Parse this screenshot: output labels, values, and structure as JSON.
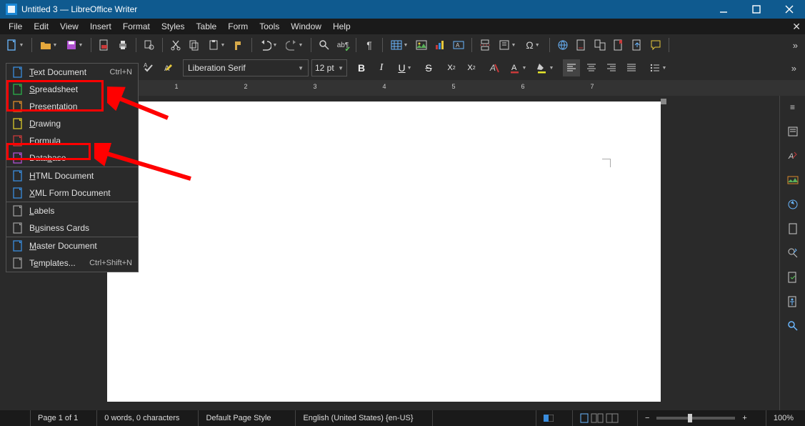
{
  "titlebar": {
    "title": "Untitled 3 — LibreOffice Writer"
  },
  "menubar": {
    "items": [
      "File",
      "Edit",
      "View",
      "Insert",
      "Format",
      "Styles",
      "Table",
      "Form",
      "Tools",
      "Window",
      "Help"
    ]
  },
  "toolbar2": {
    "font_name": "Liberation Serif",
    "font_size": "12 pt"
  },
  "newdoc_menu": {
    "items": [
      {
        "label": "Text Document",
        "accel": "Ctrl+N",
        "iconColor": "#3a8dde",
        "key": "T"
      },
      {
        "label": "Spreadsheet",
        "accel": "",
        "iconColor": "#2ab04a",
        "key": "S"
      },
      {
        "label": "Presentation",
        "accel": "",
        "iconColor": "#d98a2a",
        "key": "P"
      },
      {
        "label": "Drawing",
        "accel": "",
        "iconColor": "#d9c92a",
        "key": "D"
      },
      {
        "label": "Formula",
        "accel": "",
        "iconColor": "#c83a3a",
        "key": "F"
      },
      {
        "label": "Database",
        "accel": "",
        "iconColor": "#b050d0",
        "key": "b"
      },
      {
        "label": "HTML Document",
        "accel": "",
        "iconColor": "#3a8dde",
        "key": "H"
      },
      {
        "label": "XML Form Document",
        "accel": "",
        "iconColor": "#3a8dde",
        "key": "X"
      },
      {
        "label": "Labels",
        "accel": "",
        "iconColor": "#999",
        "key": "L"
      },
      {
        "label": "Business Cards",
        "accel": "",
        "iconColor": "#999",
        "key": "u"
      },
      {
        "label": "Master Document",
        "accel": "",
        "iconColor": "#3a8dde",
        "key": "M"
      },
      {
        "label": "Templates...",
        "accel": "Ctrl+Shift+N",
        "iconColor": "#999",
        "key": "e"
      }
    ]
  },
  "ruler": {
    "numbers": [
      "1",
      "2",
      "3",
      "4",
      "5",
      "6",
      "7"
    ]
  },
  "statusbar": {
    "page": "Page 1 of 1",
    "words": "0 words, 0 characters",
    "style": "Default Page Style",
    "lang": "English (United States) {en-US}",
    "zoom": "100%"
  }
}
